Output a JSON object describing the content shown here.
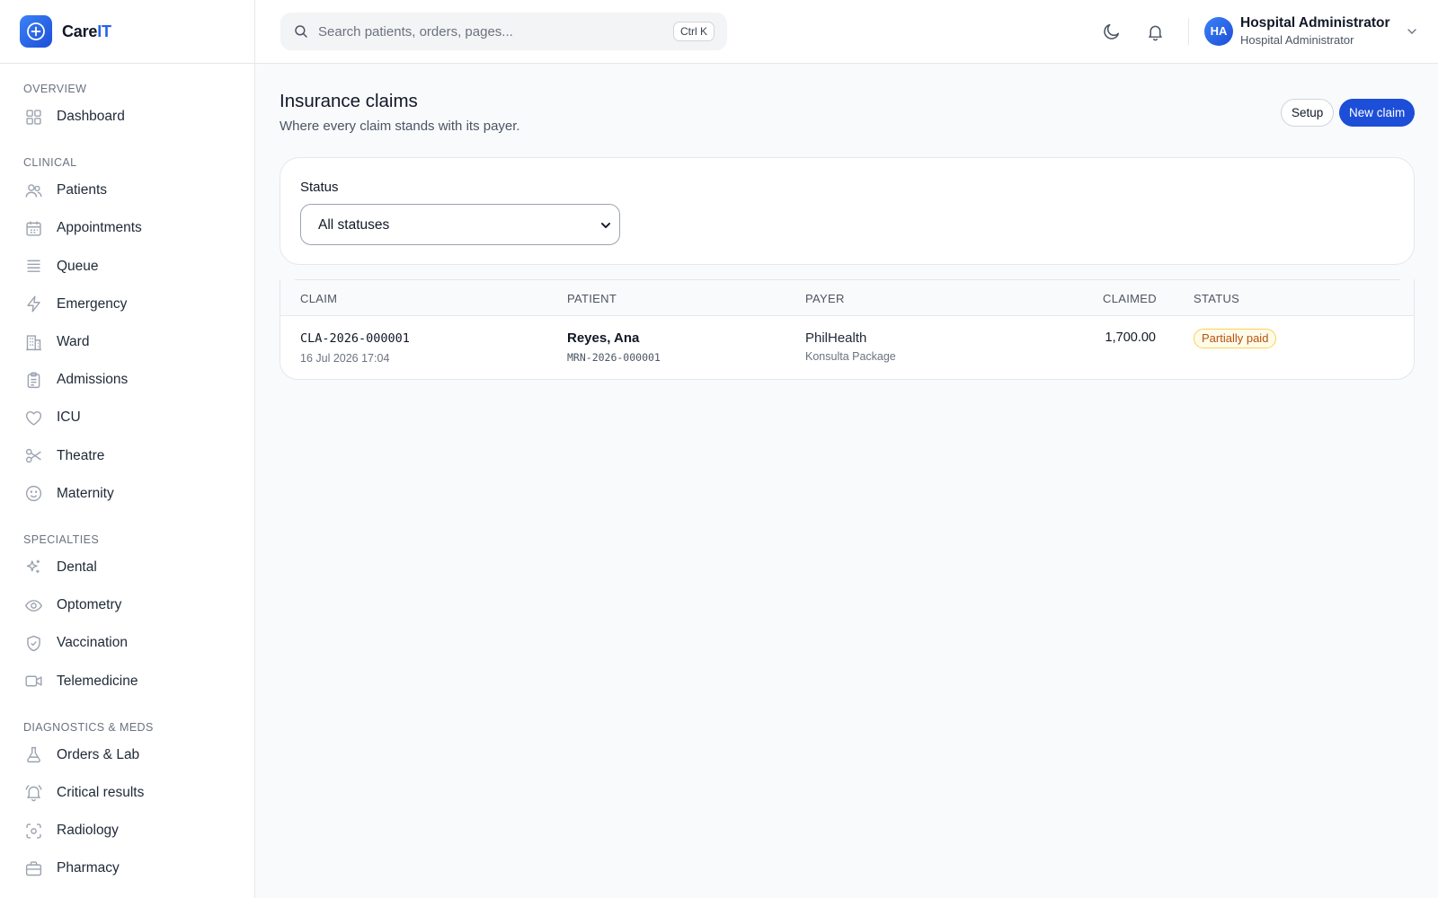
{
  "app": {
    "brand_prefix": "Care",
    "brand_accent": "IT"
  },
  "sidebar": {
    "groups": [
      {
        "title": "Overview",
        "items": [
          {
            "label": "Dashboard",
            "icon": "grid-icon"
          }
        ]
      },
      {
        "title": "Clinical",
        "items": [
          {
            "label": "Patients",
            "icon": "users-icon"
          },
          {
            "label": "Appointments",
            "icon": "calendar-icon"
          },
          {
            "label": "Queue",
            "icon": "list-icon"
          },
          {
            "label": "Emergency",
            "icon": "lightning-icon"
          },
          {
            "label": "Ward",
            "icon": "building-icon"
          },
          {
            "label": "Admissions",
            "icon": "clipboard-icon"
          },
          {
            "label": "ICU",
            "icon": "heart-icon"
          },
          {
            "label": "Theatre",
            "icon": "scissors-icon"
          },
          {
            "label": "Maternity",
            "icon": "smile-icon"
          }
        ]
      },
      {
        "title": "Specialties",
        "items": [
          {
            "label": "Dental",
            "icon": "sparkles-icon"
          },
          {
            "label": "Optometry",
            "icon": "eye-icon"
          },
          {
            "label": "Vaccination",
            "icon": "shield-check-icon"
          },
          {
            "label": "Telemedicine",
            "icon": "video-icon"
          }
        ]
      },
      {
        "title": "Diagnostics & Meds",
        "items": [
          {
            "label": "Orders & Lab",
            "icon": "flask-icon"
          },
          {
            "label": "Critical results",
            "icon": "bell-alert-icon"
          },
          {
            "label": "Radiology",
            "icon": "scan-icon"
          },
          {
            "label": "Pharmacy",
            "icon": "medkit-icon"
          }
        ]
      }
    ]
  },
  "header": {
    "search_placeholder": "Search patients, orders, pages...",
    "search_shortcut": "Ctrl K",
    "user_initials": "HA",
    "user_name": "Hospital Administrator",
    "user_role": "Hospital Administrator"
  },
  "page": {
    "title": "Insurance claims",
    "subtitle": "Where every claim stands with its payer.",
    "setup_label": "Setup",
    "new_label": "New claim"
  },
  "filter": {
    "label": "Status",
    "selected": "All statuses"
  },
  "table": {
    "columns": [
      "CLAIM",
      "PATIENT",
      "PAYER",
      "CLAIMED",
      "STATUS"
    ],
    "rows": [
      {
        "claim_id": "CLA-2026-000001",
        "date": "16 Jul 2026 17:04",
        "patient": "Reyes, Ana",
        "mrn": "MRN-2026-000001",
        "payer": "PhilHealth",
        "plan": "Konsulta Package",
        "amount": "1,700.00",
        "status": "Partially paid"
      }
    ]
  },
  "colors": {
    "primary": "#1d4ed8",
    "status_partial_text": "#b45309",
    "status_partial_bg": "#fffbeb"
  }
}
